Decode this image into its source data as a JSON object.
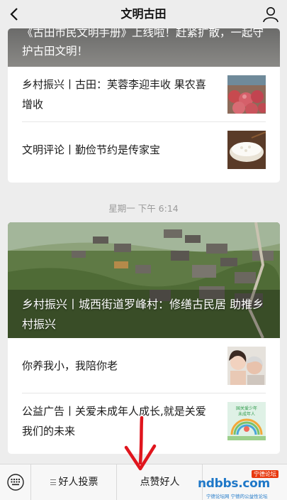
{
  "nav": {
    "title": "文明古田",
    "back_icon": "chevron-left-icon",
    "profile_icon": "person-icon"
  },
  "card1": {
    "cover_title": "《古田市民文明手册》上线啦！赶紧扩散，一起守护古田文明！",
    "articles": [
      {
        "title": "乡村振兴丨古田：芙蓉李迎丰收 果农喜增收",
        "thumb": "plums-photo"
      },
      {
        "title": "文明评论丨勤俭节约是传家宝",
        "thumb": "rice-bowl-photo"
      }
    ]
  },
  "timestamp": "星期一 下午 6:14",
  "card2": {
    "cover_title": "乡村振兴丨城西街道罗峰村：修缮古民居 助推乡村振兴",
    "articles": [
      {
        "title": "你养我小，我陪你老",
        "thumb": "elderly-portrait-photo"
      },
      {
        "title": "公益广告丨关爱未成年人成长,就是关爱我们的未来",
        "thumb": "poster-photo",
        "thumb_text": "国关爱少年 未成年人"
      }
    ]
  },
  "bottom_menu": {
    "keyboard_icon": "keyboard-icon",
    "items": [
      "好人投票",
      "点赞好人",
      ""
    ]
  },
  "watermark": {
    "tag": "宁德论坛",
    "brand": "ndbbs.com",
    "sub": "宁德论坛网 宁德的公益性论坛"
  },
  "colors": {
    "background": "#ededed",
    "card": "#ffffff",
    "annotation_arrow": "#e0151d",
    "watermark": "#1f78c8"
  }
}
